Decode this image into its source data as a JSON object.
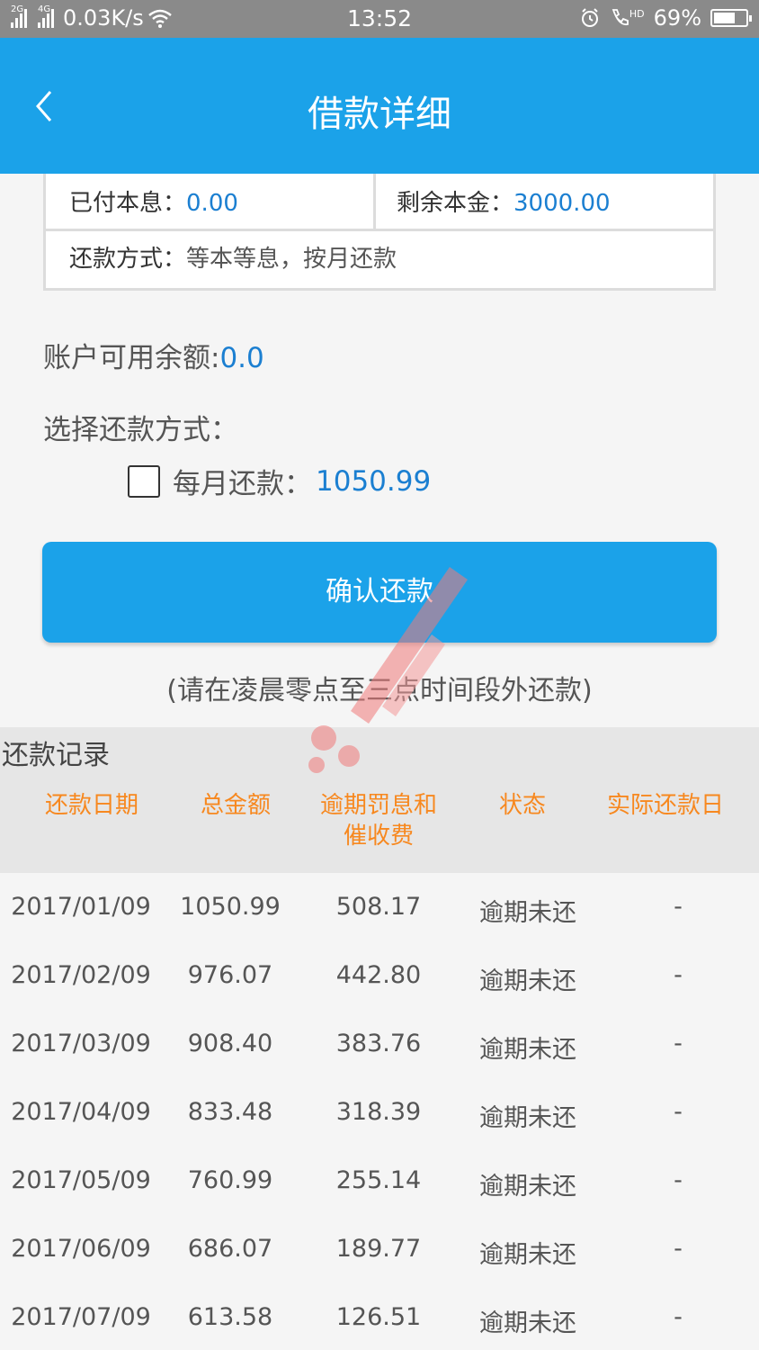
{
  "status_bar": {
    "sim1": "2G",
    "sim2": "4G",
    "net_speed": "0.03K/s",
    "time": "13:52",
    "hd_label": "HD",
    "battery": "69%"
  },
  "header": {
    "title": "借款详细",
    "back_icon": "chevron-left-icon"
  },
  "info": {
    "paid_label": "已付本息：",
    "paid_value": "0.00",
    "remaining_label": "剩余本金：",
    "remaining_value": "3000.00",
    "method_label": "还款方式：",
    "method_value": "等本等息，按月还款"
  },
  "balance": {
    "label": "账户可用余额:",
    "value": "0.0"
  },
  "choose_label": "选择还款方式：",
  "monthly": {
    "label": "每月还款：",
    "value": "1050.99",
    "checked": false
  },
  "confirm_label": "确认还款",
  "notice": "(请在凌晨零点至三点时间段外还款)",
  "records": {
    "title": "还款记录",
    "columns": [
      "还款日期",
      "总金额",
      "逾期罚息和",
      "催收费",
      "状态",
      "实际还款日"
    ],
    "rows": [
      [
        "2017/01/09",
        "1050.99",
        "508.17",
        "逾期未还",
        "-"
      ],
      [
        "2017/02/09",
        "976.07",
        "442.80",
        "逾期未还",
        "-"
      ],
      [
        "2017/03/09",
        "908.40",
        "383.76",
        "逾期未还",
        "-"
      ],
      [
        "2017/04/09",
        "833.48",
        "318.39",
        "逾期未还",
        "-"
      ],
      [
        "2017/05/09",
        "760.99",
        "255.14",
        "逾期未还",
        "-"
      ],
      [
        "2017/06/09",
        "686.07",
        "189.77",
        "逾期未还",
        "-"
      ],
      [
        "2017/07/09",
        "613.58",
        "126.51",
        "逾期未还",
        "-"
      ]
    ]
  },
  "colors": {
    "primary": "#1ba2e9",
    "accent": "#f7881f",
    "value_blue": "#1b7fd1"
  }
}
